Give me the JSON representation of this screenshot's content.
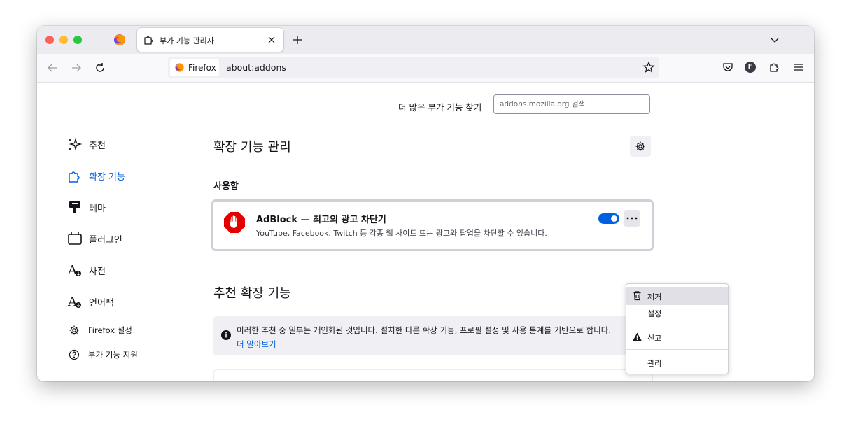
{
  "tab": {
    "title": "부가 기능 관리자",
    "icon": "puzzle-icon"
  },
  "urlbar": {
    "identity_label": "Firefox",
    "url": "about:addons"
  },
  "toolbar_icons": [
    "pocket-icon",
    "account-avatar-icon",
    "extensions-icon",
    "hamburger-menu-icon"
  ],
  "avatar_letter": "F",
  "find": {
    "label": "더 많은 부가 기능 찾기",
    "placeholder": "addons.mozilla.org 검색"
  },
  "sidebar": {
    "items": [
      {
        "label": "추천",
        "icon": "sparkle-icon"
      },
      {
        "label": "확장 기능",
        "icon": "puzzle-icon",
        "active": true
      },
      {
        "label": "테마",
        "icon": "paintbrush-icon"
      },
      {
        "label": "플러그인",
        "icon": "plugin-icon"
      },
      {
        "label": "사전",
        "icon": "dictionary-icon"
      },
      {
        "label": "언어팩",
        "icon": "language-pack-icon"
      }
    ],
    "footer": [
      {
        "label": "Firefox 설정",
        "icon": "gear-icon"
      },
      {
        "label": "부가 기능 지원",
        "icon": "help-icon"
      }
    ]
  },
  "main": {
    "heading": "확장 기능 관리",
    "enabled_section": "사용함",
    "addon": {
      "name": "AdBlock — 최고의 광고 차단기",
      "description": "YouTube, Facebook, Twitch 등 각종 웹 사이트 뜨는 광고와 팝업을 차단할 수 있습니다.",
      "enabled": true
    },
    "recommended_heading": "추천 확장 기능",
    "notice": {
      "text": "이러한 추천 중 일부는 개인화된 것입니다. 설치한 다른 확장 기능, 프로필 설정 및 사용 통계를 기반으로 합니다.",
      "link": "더 알아보기"
    }
  },
  "context_menu": {
    "items": [
      {
        "label": "제거",
        "icon": "trash-icon"
      },
      {
        "label": "설정",
        "icon": ""
      },
      {
        "label": "신고",
        "icon": "warning-icon"
      },
      {
        "label": "관리",
        "icon": ""
      }
    ]
  },
  "colors": {
    "accent": "#0061e0",
    "adblock_red": "#e40000"
  }
}
